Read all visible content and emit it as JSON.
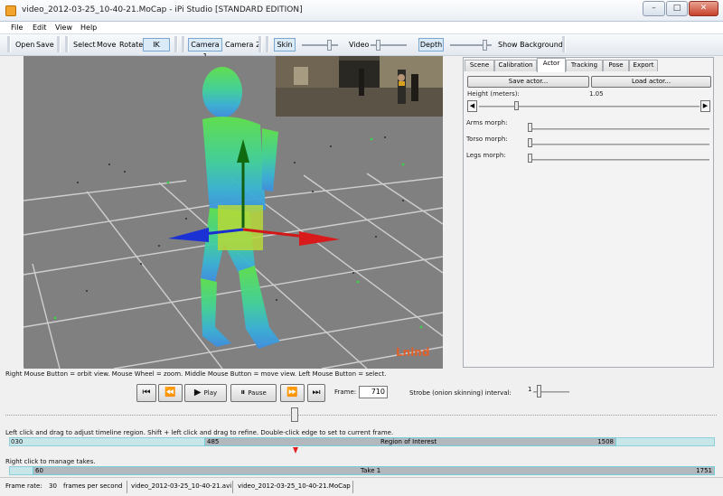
{
  "window": {
    "title": "video_2012-03-25_10-40-21.MoCap - iPi Studio [STANDARD EDITION]",
    "minimize": "–",
    "maximize": "□",
    "close": "✕"
  },
  "menu": [
    "File",
    "Edit",
    "View",
    "Help"
  ],
  "toolbar": {
    "open": "Open",
    "save": "Save",
    "select": "Select",
    "move": "Move",
    "rotate": "Rotate",
    "rotate_axis": "IK",
    "camera1": "Camera 1",
    "camera2": "Camera 2",
    "skin": "Skin",
    "video": "Video",
    "depth": "Depth",
    "show_background": "Show Background"
  },
  "viewport": {
    "brand": "Lnlnd"
  },
  "tabs": [
    {
      "label": "Scene",
      "active": false
    },
    {
      "label": "Calibration",
      "active": false
    },
    {
      "label": "Actor",
      "active": true
    },
    {
      "label": "Tracking",
      "active": false
    },
    {
      "label": "Pose",
      "active": false
    },
    {
      "label": "Export",
      "active": false
    }
  ],
  "actor_panel": {
    "save_actor": "Save actor...",
    "load_actor": "Load actor...",
    "height_label": "Height (meters):",
    "height_value": "1.05",
    "height_fraction": 0.16,
    "arms_label": "Arms morph:",
    "torso_label": "Torso morph:",
    "legs_label": "Legs morph:"
  },
  "hints": {
    "mouse": "Right Mouse Button = orbit view. Mouse Wheel = zoom. Middle Mouse Button = move view. Left Mouse Button = select.",
    "region": "Left click and drag to adjust timeline region. Shift + left click and drag to refine. Double-click edge to set to current frame.",
    "takes": "Right click to manage takes."
  },
  "playback": {
    "play": "Play",
    "pause": "Pause",
    "frame_label": "Frame:",
    "frame_value": "710",
    "strobe_label": "Strobe (onion skinning) interval:",
    "strobe_value": "1"
  },
  "timeline": {
    "region_start_total": "030",
    "region_start": "485",
    "region_label": "Region of Interest",
    "region_end": "1508",
    "take_start": "60",
    "take_label": "Take 1",
    "take_end": "1751"
  },
  "status": {
    "frame_rate_label": "Frame rate:",
    "frame_rate_value": "30",
    "frame_rate_unit": "frames per second",
    "video_file": "video_2012-03-25_10-40-21.avi",
    "mocap_file": "video_2012-03-25_10-40-21.MoCap"
  },
  "colors": {
    "accent": "#75d0dc",
    "viewport_bg": "#808080",
    "brand": "#e0602c"
  }
}
